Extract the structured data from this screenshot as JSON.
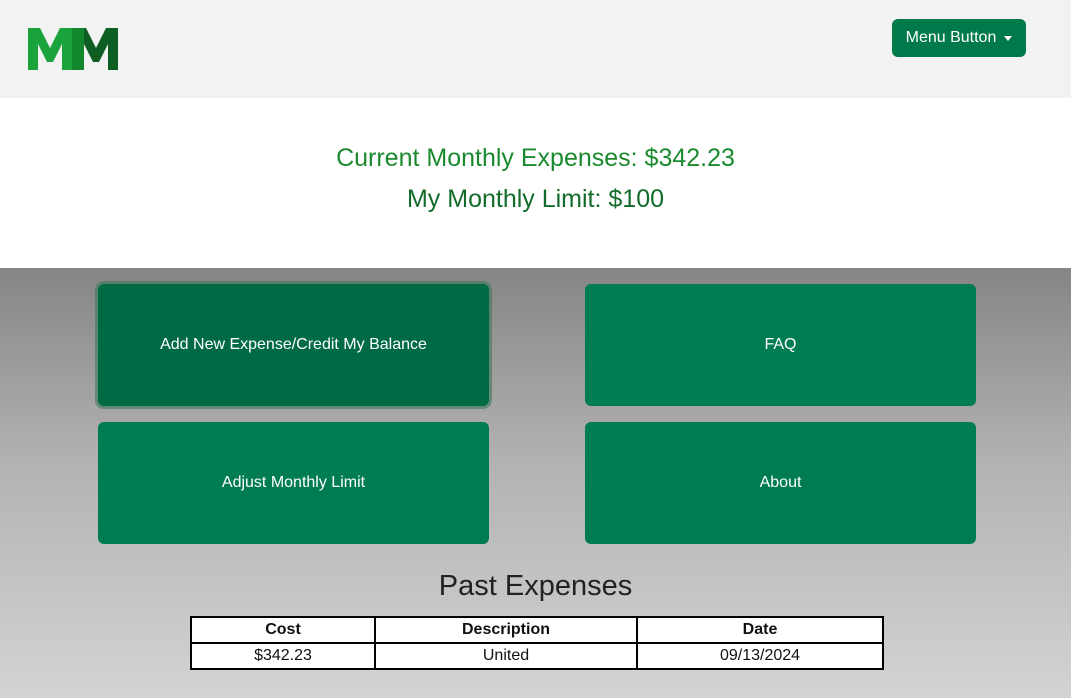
{
  "header": {
    "logo_text": "MM",
    "menu_button_label": "Menu Button"
  },
  "summary": {
    "current_expenses": "Current Monthly Expenses: $342.23",
    "monthly_limit": "My Monthly Limit: $100"
  },
  "actions": {
    "add_expense": "Add New Expense/Credit My Balance",
    "faq": "FAQ",
    "adjust_limit": "Adjust Monthly Limit",
    "about": "About"
  },
  "past_expenses": {
    "title": "Past Expenses",
    "columns": [
      "Cost",
      "Description",
      "Date"
    ],
    "rows": [
      [
        "$342.23",
        "United",
        "09/13/2024"
      ]
    ]
  },
  "colors": {
    "brand_green": "#007c52",
    "logo_light": "#1aa33a",
    "logo_dark": "#0d5e22"
  }
}
